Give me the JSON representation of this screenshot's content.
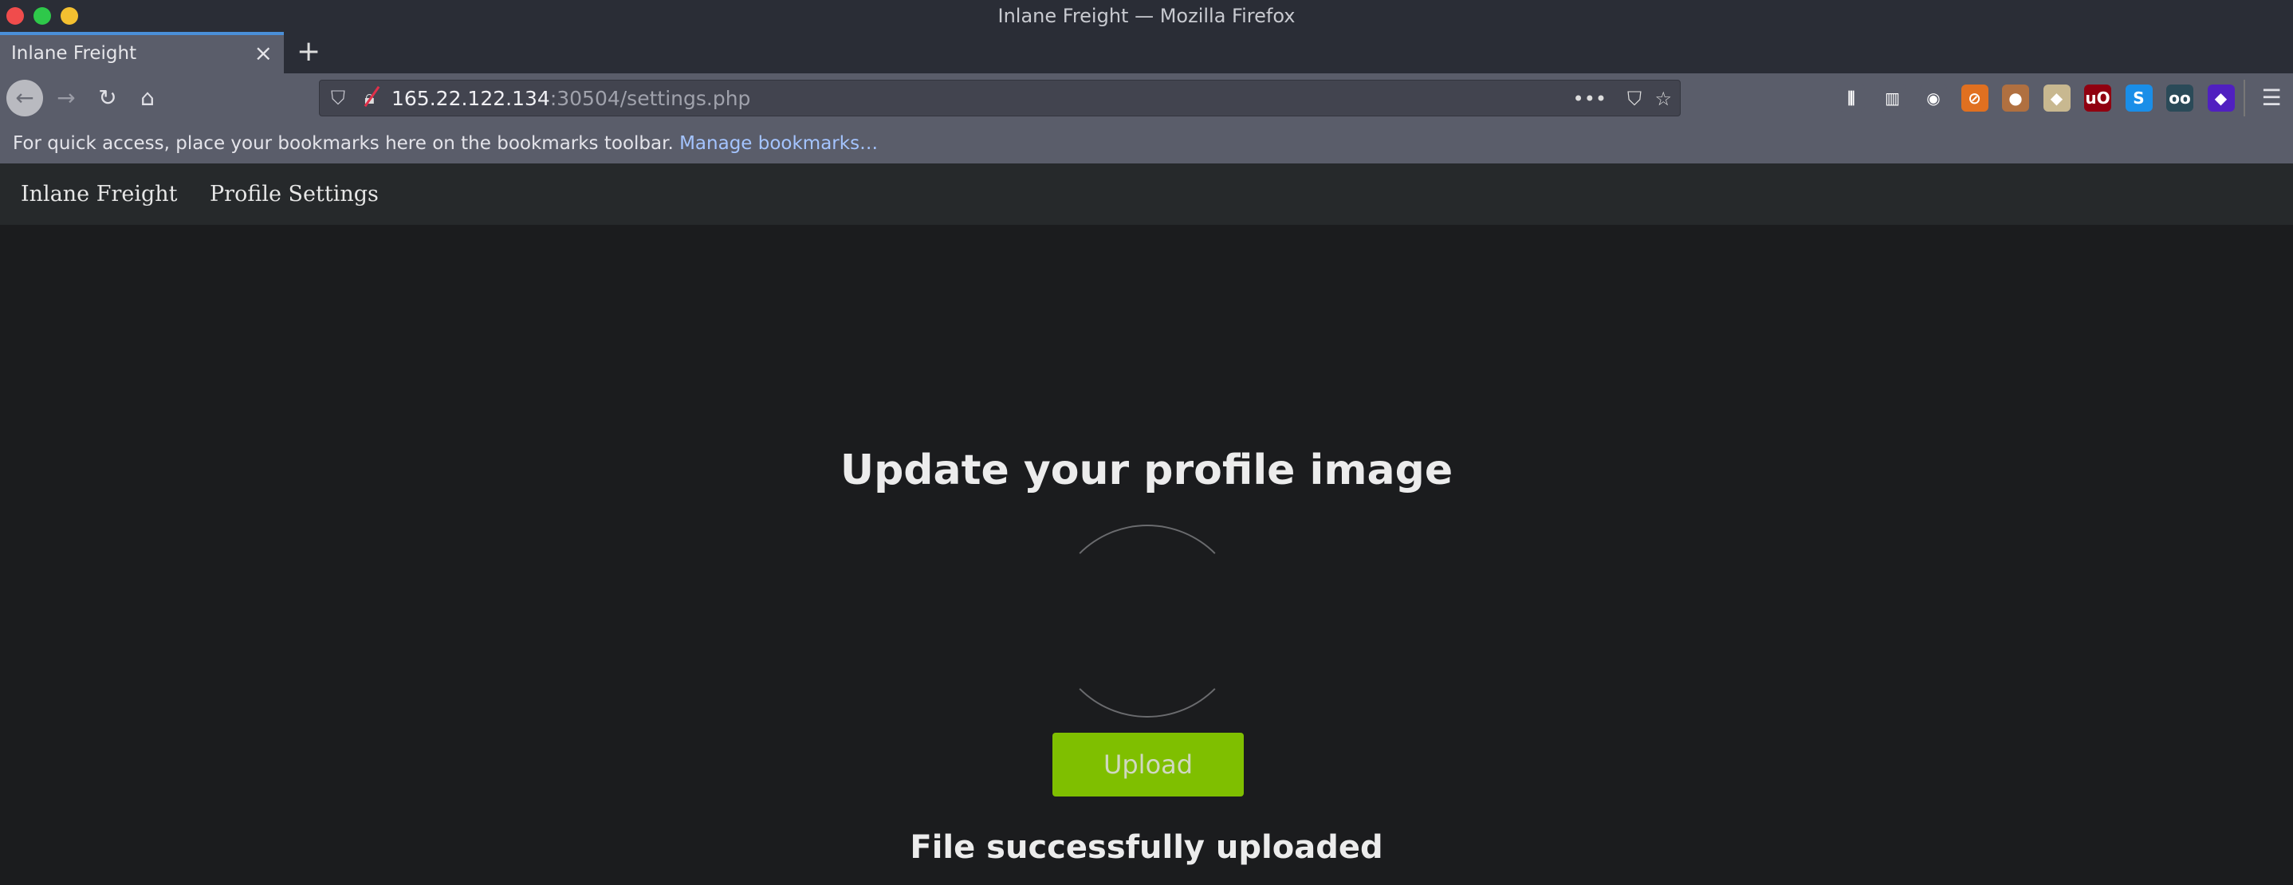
{
  "window": {
    "title": "Inlane Freight — Mozilla Firefox"
  },
  "tabs": [
    {
      "label": "Inlane Freight",
      "close": "×"
    }
  ],
  "new_tab": "+",
  "url": {
    "host": "165.22.122.134",
    "rest": ":30504/settings.php"
  },
  "url_actions": {
    "more": "•••"
  },
  "bookmarks_bar": {
    "text": "For quick access, place your bookmarks here on the bookmarks toolbar. ",
    "link": "Manage bookmarks…"
  },
  "extensions": [
    {
      "name": "library-icon",
      "glyph": "⫼",
      "color": "#5a5d6a"
    },
    {
      "name": "sidebar-icon",
      "glyph": "▥",
      "color": "#5a5d6a"
    },
    {
      "name": "account-icon",
      "glyph": "◉",
      "color": "#5a5d6a"
    },
    {
      "name": "extension-fox-icon",
      "glyph": "⊘",
      "color": "#e07020"
    },
    {
      "name": "cookie-icon",
      "glyph": "●",
      "color": "#b07040"
    },
    {
      "name": "badger-icon",
      "glyph": "◆",
      "color": "#c8b890"
    },
    {
      "name": "ublock-icon",
      "glyph": "uO",
      "color": "#900010"
    },
    {
      "name": "s-extension-icon",
      "glyph": "S",
      "color": "#1a8ee8"
    },
    {
      "name": "spy-extension-icon",
      "glyph": "oo",
      "color": "#2a4a58"
    },
    {
      "name": "layers-extension-icon",
      "glyph": "◆",
      "color": "#5020c0"
    }
  ],
  "site_nav": {
    "brand": "Inlane Freight",
    "link": "Profile Settings"
  },
  "main": {
    "heading": "Update your profile image",
    "upload_button": "Upload",
    "status": "File successfully uploaded"
  },
  "colors": {
    "accent": "#7fbf00",
    "background": "#1b1c1e"
  }
}
